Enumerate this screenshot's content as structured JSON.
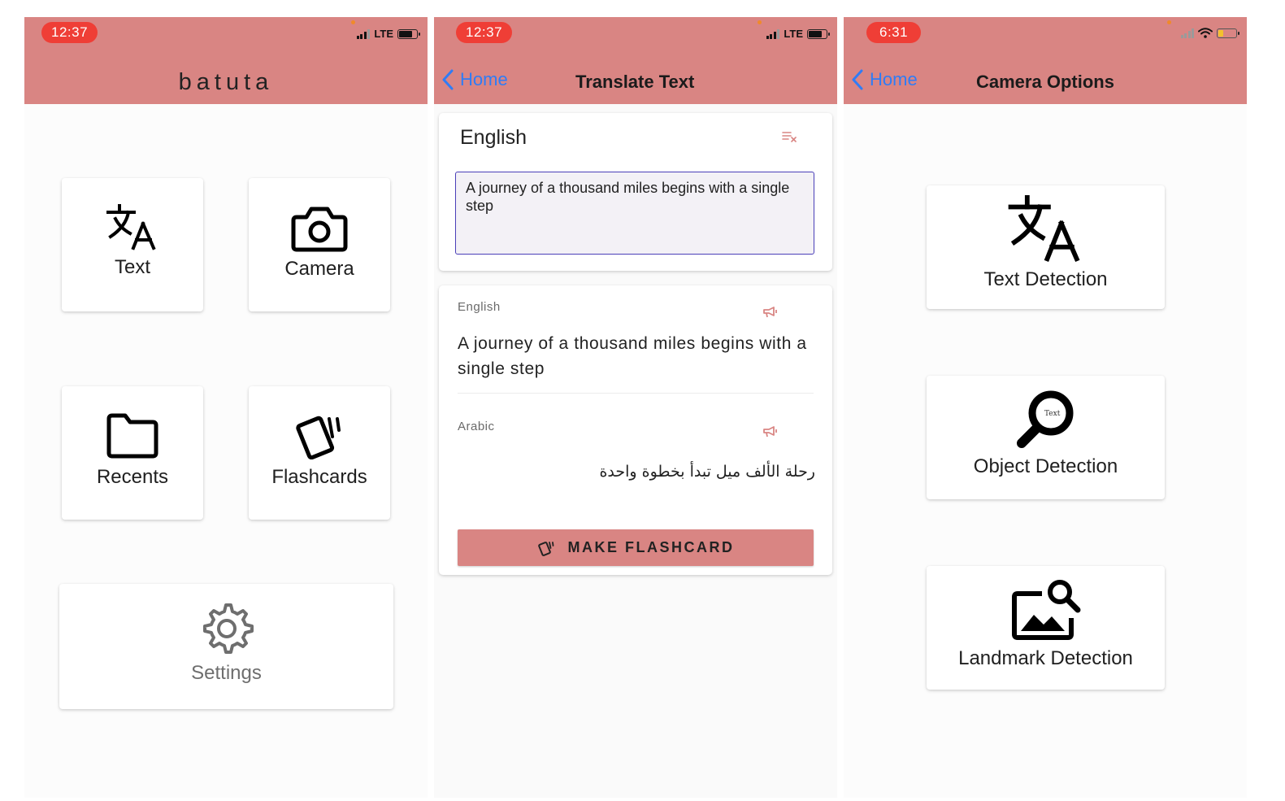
{
  "screens": [
    {
      "status": {
        "time": "12:37",
        "network": "LTE"
      },
      "header": {
        "title": "batuta"
      },
      "tiles": [
        {
          "label": "Text",
          "icon": "translate-icon"
        },
        {
          "label": "Camera",
          "icon": "camera-icon"
        },
        {
          "label": "Recents",
          "icon": "folder-icon"
        },
        {
          "label": "Flashcards",
          "icon": "flashcards-icon"
        },
        {
          "label": "Settings",
          "icon": "gear-icon"
        }
      ]
    },
    {
      "status": {
        "time": "12:37",
        "network": "LTE"
      },
      "header": {
        "back": "Home",
        "title": "Translate Text"
      },
      "input_card": {
        "language": "English",
        "text": "A journey of a thousand miles begins with a single step"
      },
      "output_card": {
        "source_language": "English",
        "source_text": "A journey of a thousand miles begins with a single step",
        "target_language": "Arabic",
        "target_text": "رحلة الألف ميل تبدأ بخطوة واحدة",
        "button": "MAKE FLASHCARD"
      }
    },
    {
      "status": {
        "time": "6:31"
      },
      "header": {
        "back": "Home",
        "title": "Camera Options"
      },
      "options": [
        {
          "label": "Text Detection",
          "icon": "translate-icon"
        },
        {
          "label": "Object Detection",
          "icon": "magnifier-icon",
          "icon_text": "Text"
        },
        {
          "label": "Landmark Detection",
          "icon": "image-search-icon"
        }
      ]
    }
  ],
  "colors": {
    "header": "#d98583",
    "time_pill": "#ef3e36",
    "back_link": "#2f7cf6",
    "input_border": "#4a3fb8"
  }
}
